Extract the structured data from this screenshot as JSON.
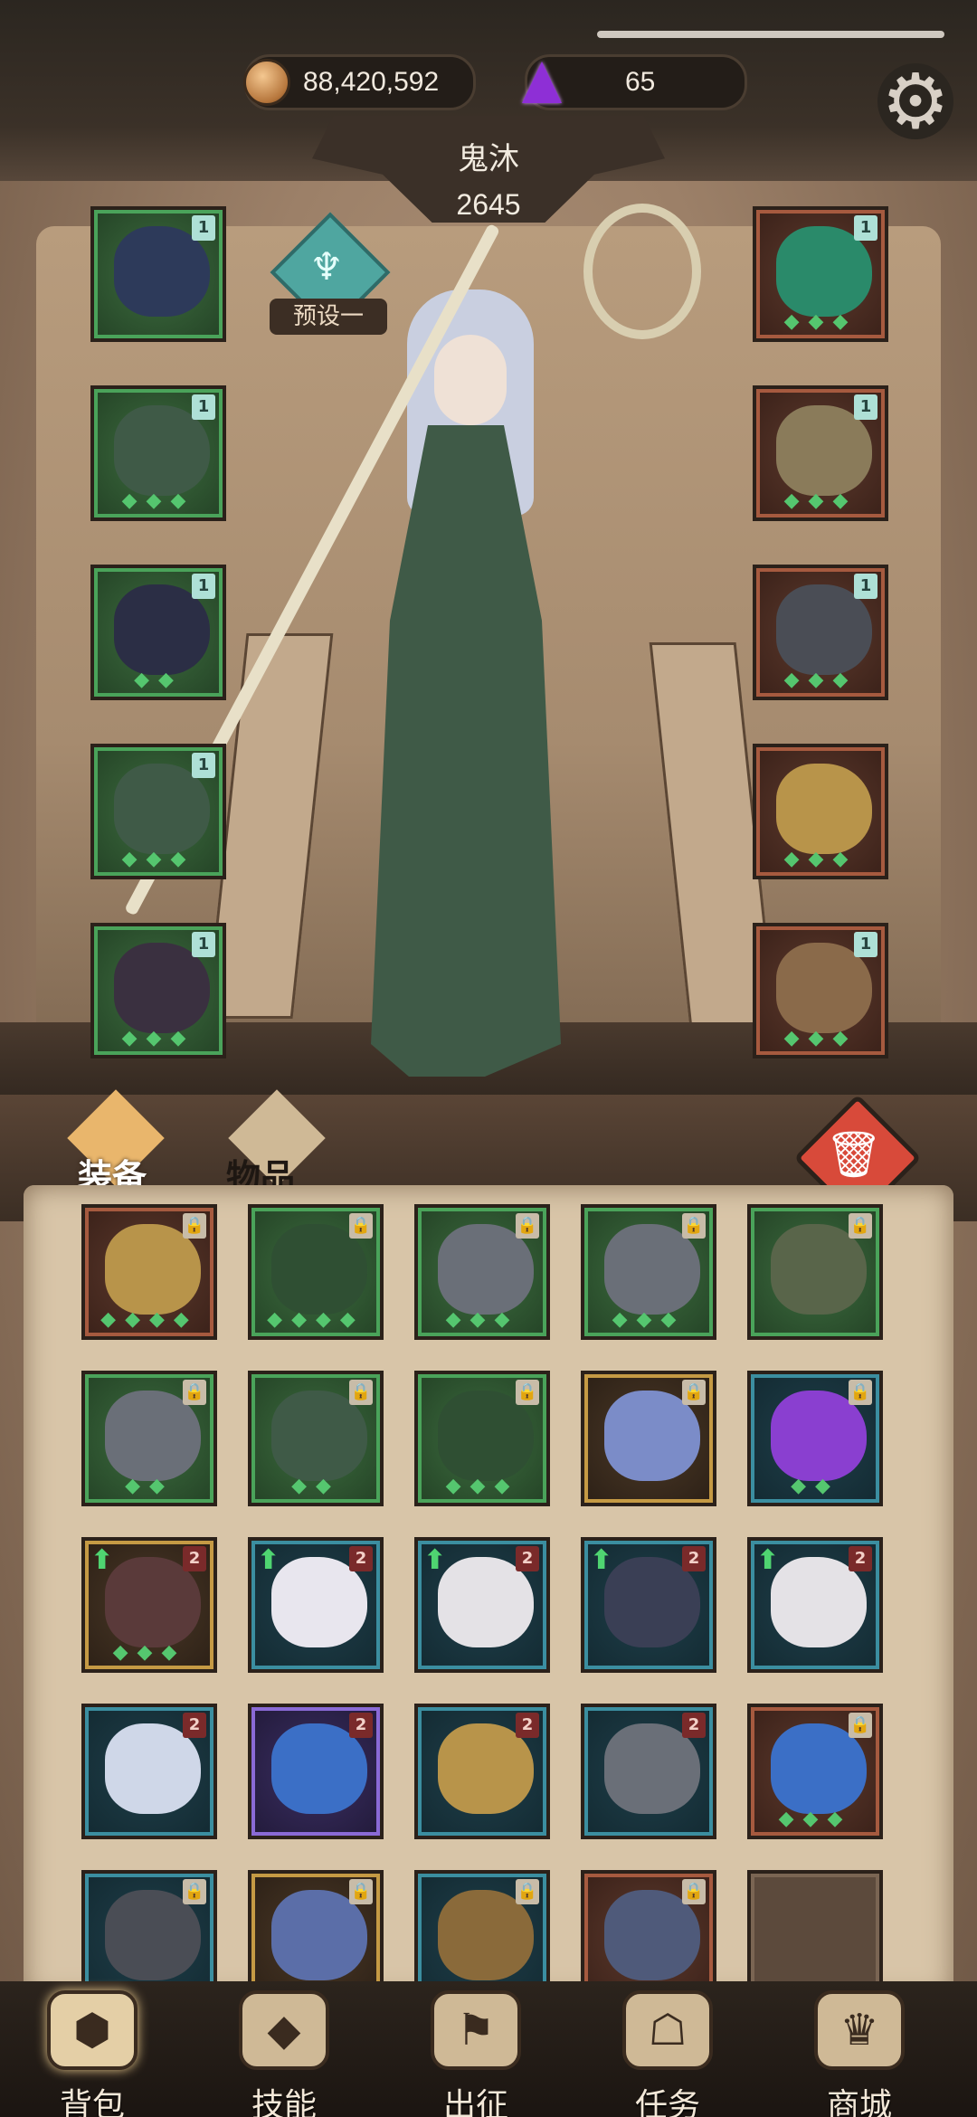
{
  "currency": {
    "coin_amount": "88,420,592",
    "gem_amount": "65"
  },
  "hero": {
    "name": "鬼沐",
    "power": "2645",
    "preset_label": "预设一"
  },
  "icons": {
    "settings": "gear-icon",
    "coin": "coin-icon",
    "gem": "gem-icon",
    "trash": "trash-icon"
  },
  "equipped_left": [
    {
      "item": "mirror-amulet",
      "rarity": "green",
      "tag": "1"
    },
    {
      "item": "cloak",
      "rarity": "green",
      "tag": "1",
      "stars": "◆◆◆"
    },
    {
      "item": "hat",
      "rarity": "green",
      "tag": "1",
      "stars": "◆◆"
    },
    {
      "item": "pants",
      "rarity": "green",
      "tag": "1",
      "stars": "◆◆◆"
    },
    {
      "item": "boots",
      "rarity": "green",
      "tag": "1",
      "stars": "◆◆◆"
    }
  ],
  "equipped_right": [
    {
      "item": "gem-necklace",
      "rarity": "red",
      "tag": "1",
      "stars": "◆◆◆"
    },
    {
      "item": "gauntlet",
      "rarity": "red",
      "tag": "1",
      "stars": "◆◆◆"
    },
    {
      "item": "ring",
      "rarity": "red",
      "tag": "1",
      "stars": "◆◆◆"
    },
    {
      "item": "staff",
      "rarity": "red",
      "tag": "",
      "stars": "◆◆◆"
    },
    {
      "item": "tome",
      "rarity": "red",
      "tag": "1",
      "stars": "◆◆◆"
    }
  ],
  "tabs": {
    "equipment": "装备",
    "items": "物品"
  },
  "bag": [
    {
      "rarity": "red",
      "tag": "lock",
      "art": "#b8944a",
      "stars": "◆◆◆◆"
    },
    {
      "rarity": "green",
      "tag": "lock",
      "art": "#2f4f33",
      "stars": "◆◆◆◆"
    },
    {
      "rarity": "green",
      "tag": "lock",
      "art": "#6a6f78",
      "stars": "◆◆◆"
    },
    {
      "rarity": "green",
      "tag": "lock",
      "art": "#6a6f78",
      "stars": "◆◆◆"
    },
    {
      "rarity": "green",
      "tag": "lock",
      "art": "#59654a",
      "stars": ""
    },
    {
      "rarity": "green",
      "tag": "lock",
      "art": "#6a6f78",
      "stars": "◆◆"
    },
    {
      "rarity": "green",
      "tag": "lock",
      "art": "#3f5a47",
      "stars": "◆◆"
    },
    {
      "rarity": "green",
      "tag": "lock",
      "art": "#2f4f33",
      "stars": "◆◆◆"
    },
    {
      "rarity": "gold",
      "tag": "lock",
      "art": "#7b8cc8",
      "stars": ""
    },
    {
      "rarity": "teal",
      "tag": "lock",
      "art": "#8a3fd0",
      "stars": "◆◆"
    },
    {
      "rarity": "gold",
      "tag": "2",
      "art": "#5a3a3a",
      "stars": "◆◆◆",
      "up": true
    },
    {
      "rarity": "teal",
      "tag": "2",
      "art": "#e8e6ee",
      "stars": "",
      "up": true
    },
    {
      "rarity": "teal",
      "tag": "2",
      "art": "#e4e2e6",
      "stars": "",
      "up": true
    },
    {
      "rarity": "teal",
      "tag": "2",
      "art": "#3a3f55",
      "stars": "",
      "up": true
    },
    {
      "rarity": "teal",
      "tag": "2",
      "art": "#e4e2e6",
      "stars": "",
      "up": true
    },
    {
      "rarity": "teal",
      "tag": "2",
      "art": "#cfd7e8",
      "stars": ""
    },
    {
      "rarity": "purple",
      "tag": "2",
      "art": "#3b6fc6",
      "stars": ""
    },
    {
      "rarity": "teal",
      "tag": "2",
      "art": "#b8944a",
      "stars": ""
    },
    {
      "rarity": "teal",
      "tag": "2",
      "art": "#6a6f78",
      "stars": ""
    },
    {
      "rarity": "red",
      "tag": "lock",
      "art": "#3b6fc6",
      "stars": "◆◆◆"
    },
    {
      "rarity": "teal",
      "tag": "lock",
      "art": "#4a4d55",
      "stars": ""
    },
    {
      "rarity": "gold",
      "tag": "lock",
      "art": "#5b6ea8",
      "stars": ""
    },
    {
      "rarity": "teal",
      "tag": "lock",
      "art": "#8a6a3a",
      "stars": ""
    },
    {
      "rarity": "red",
      "tag": "lock",
      "art": "#4f5a7a",
      "stars": ""
    },
    {
      "rarity": "empty",
      "tag": "",
      "art": "",
      "stars": ""
    }
  ],
  "nav": [
    {
      "label": "背包",
      "icon": "backpack-icon",
      "glyph": "⬢",
      "active": true
    },
    {
      "label": "技能",
      "icon": "skill-icon",
      "glyph": "◆"
    },
    {
      "label": "出征",
      "icon": "expedition-icon",
      "glyph": "⚑"
    },
    {
      "label": "任务",
      "icon": "quest-icon",
      "glyph": "☖"
    },
    {
      "label": "商城",
      "icon": "shop-icon",
      "glyph": "♛"
    }
  ]
}
